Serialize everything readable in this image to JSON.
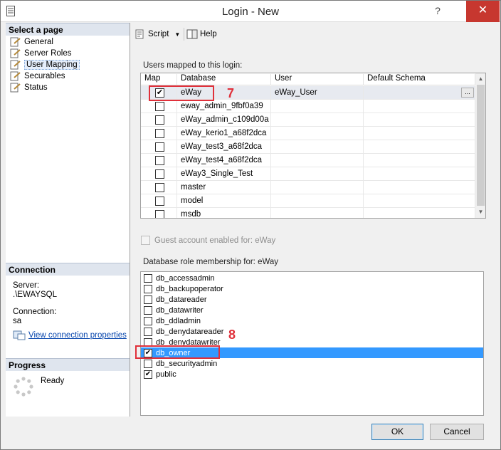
{
  "window": {
    "title": "Login - New",
    "help_glyph": "?",
    "close_glyph": "✕"
  },
  "left": {
    "select_page_header": "Select a page",
    "pages": [
      {
        "label": "General"
      },
      {
        "label": "Server Roles"
      },
      {
        "label": "User Mapping",
        "selected": true
      },
      {
        "label": "Securables"
      },
      {
        "label": "Status"
      }
    ],
    "connection_header": "Connection",
    "server_label": "Server:",
    "server_value": ".\\EWAYSQL",
    "connection_label": "Connection:",
    "connection_value": "sa",
    "view_connection_link": "View connection properties",
    "progress_header": "Progress",
    "progress_status": "Ready"
  },
  "toolbar": {
    "script_label": "Script",
    "help_label": "Help",
    "dropdown_glyph": "▼"
  },
  "users": {
    "group_label": "Users mapped to this login:",
    "columns": [
      "Map",
      "Database",
      "User",
      "Default Schema"
    ],
    "rows": [
      {
        "checked": true,
        "database": "eWay",
        "user": "eWay_User",
        "schema": "",
        "selected": true
      },
      {
        "checked": false,
        "database": "eway_admin_9fbf0a39",
        "user": "",
        "schema": ""
      },
      {
        "checked": false,
        "database": "eWay_admin_c109d00a",
        "user": "",
        "schema": ""
      },
      {
        "checked": false,
        "database": "eWay_kerio1_a68f2dca",
        "user": "",
        "schema": ""
      },
      {
        "checked": false,
        "database": "eWay_test3_a68f2dca",
        "user": "",
        "schema": ""
      },
      {
        "checked": false,
        "database": "eWay_test4_a68f2dca",
        "user": "",
        "schema": ""
      },
      {
        "checked": false,
        "database": "eWay3_Single_Test",
        "user": "",
        "schema": ""
      },
      {
        "checked": false,
        "database": "master",
        "user": "",
        "schema": ""
      },
      {
        "checked": false,
        "database": "model",
        "user": "",
        "schema": ""
      },
      {
        "checked": false,
        "database": "msdb",
        "user": "",
        "schema": ""
      }
    ],
    "ellipsis": "...",
    "step_number": "7"
  },
  "guest_account_label": "Guest account enabled for: eWay",
  "roles": {
    "group_label": "Database role membership for: eWay",
    "items": [
      {
        "label": "db_accessadmin",
        "checked": false
      },
      {
        "label": "db_backupoperator",
        "checked": false
      },
      {
        "label": "db_datareader",
        "checked": false
      },
      {
        "label": "db_datawriter",
        "checked": false
      },
      {
        "label": "db_ddladmin",
        "checked": false
      },
      {
        "label": "db_denydatareader",
        "checked": false
      },
      {
        "label": "db_denydatawriter",
        "checked": false
      },
      {
        "label": "db_owner",
        "checked": true,
        "selected": true
      },
      {
        "label": "db_securityadmin",
        "checked": false
      },
      {
        "label": "public",
        "checked": true
      }
    ],
    "step_number": "8"
  },
  "buttons": {
    "ok": "OK",
    "cancel": "Cancel"
  },
  "colors": {
    "annotation": "#e0303a",
    "selection": "#3399ff"
  }
}
